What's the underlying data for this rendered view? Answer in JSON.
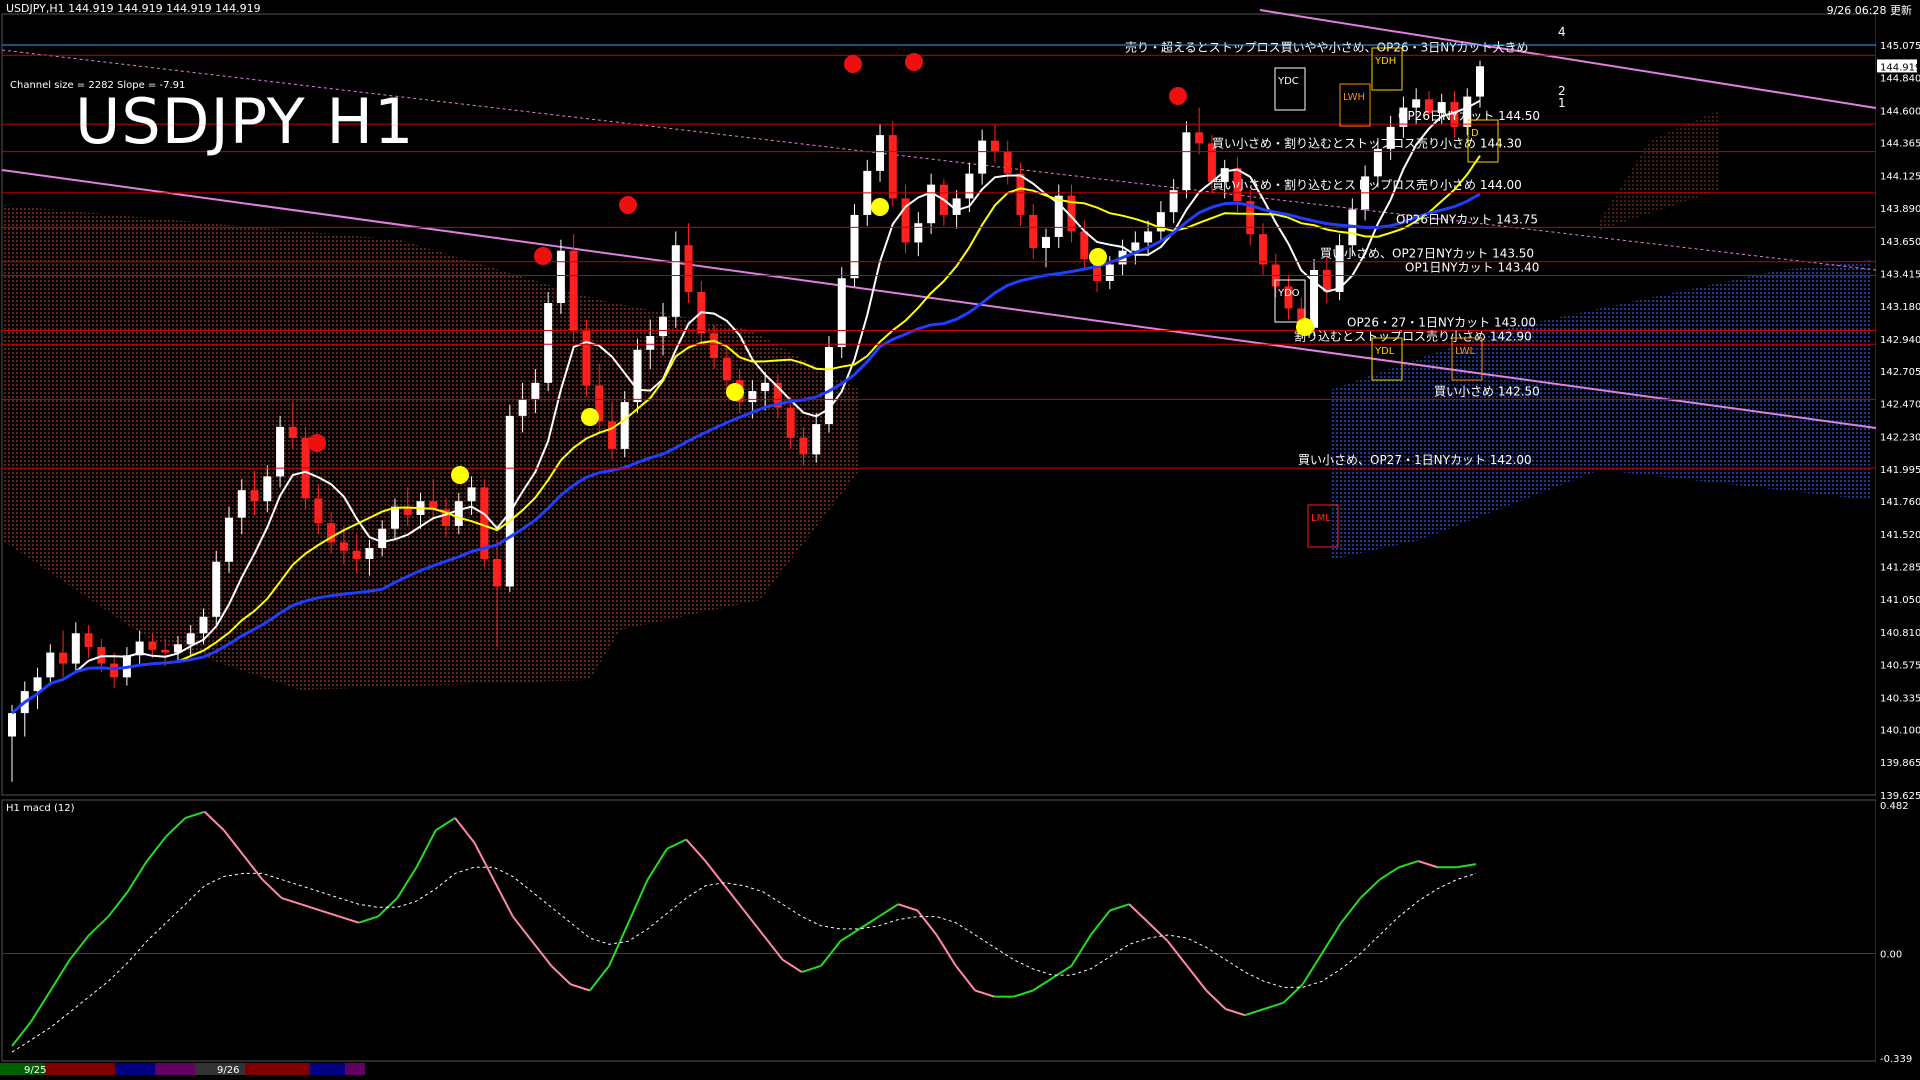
{
  "header": {
    "symbol_line": "USDJPY,H1  144.919 144.919 144.919 144.919",
    "time_line": "9/26 06:28 更新",
    "title": "USDJPY H1",
    "channel_info": "Channel size = 2282 Slope = -7.91",
    "macd_label": "H1  macd (12)"
  },
  "chart_data": [
    {
      "type": "candlestick",
      "title": "USDJPY H1",
      "ylim": [
        139.625,
        145.3
      ],
      "price_axis_ticks": [
        "145.075",
        "144.840",
        "144.600",
        "144.365",
        "144.125",
        "143.890",
        "143.650",
        "143.415",
        "143.180",
        "142.940",
        "142.705",
        "142.470",
        "142.230",
        "141.995",
        "141.760",
        "141.520",
        "141.285",
        "141.050",
        "140.810",
        "140.575",
        "140.335",
        "140.100",
        "139.865",
        "139.625"
      ],
      "current_price": "144.919",
      "x_date_labels": [
        "9/25",
        "9/26"
      ],
      "horizontal_levels": [
        {
          "price": 145.0,
          "label": "売り・超えるとストップロス買いやや小さめ、OP26・3日NYカット大きめ"
        },
        {
          "price": 144.5,
          "label": "OP26日NYカット 144.50"
        },
        {
          "price": 144.3,
          "label": "買い小さめ・割り込むとストップロス売り小さめ 144.30"
        },
        {
          "price": 144.0,
          "label": "買い小さめ・割り込むとストップロス売り小さめ 144.00"
        },
        {
          "price": 143.75,
          "label": "OP26日NYカット 143.75"
        },
        {
          "price": 143.5,
          "label": "買い小さめ、OP27日NYカット 143.50"
        },
        {
          "price": 143.4,
          "label": "OP1日NYカット 143.40"
        },
        {
          "price": 143.0,
          "label": "OP26・27・1日NYカット 143.00"
        },
        {
          "price": 142.9,
          "label": "割り込むとストップロス売り小さめ 142.90"
        },
        {
          "price": 142.5,
          "label": "買い小さめ 142.50"
        },
        {
          "price": 142.0,
          "label": "買い小さめ、OP27・1日NYカット 142.00"
        }
      ],
      "box_markers": [
        "YDH",
        "YDC",
        "LWH",
        "YDO",
        "YDL",
        "LML",
        "LWL",
        "D"
      ],
      "target_markers": [
        "4",
        "2",
        "1"
      ],
      "candles": [
        [
          140.05,
          140.28,
          139.72,
          140.22
        ],
        [
          140.22,
          140.45,
          140.05,
          140.38
        ],
        [
          140.38,
          140.55,
          140.25,
          140.48
        ],
        [
          140.48,
          140.72,
          140.42,
          140.66
        ],
        [
          140.66,
          140.82,
          140.48,
          140.58
        ],
        [
          140.58,
          140.88,
          140.52,
          140.8
        ],
        [
          140.8,
          140.86,
          140.62,
          140.7
        ],
        [
          140.7,
          140.76,
          140.52,
          140.58
        ],
        [
          140.58,
          140.66,
          140.4,
          140.48
        ],
        [
          140.48,
          140.7,
          140.42,
          140.64
        ],
        [
          140.64,
          140.82,
          140.58,
          140.74
        ],
        [
          140.74,
          140.8,
          140.62,
          140.68
        ],
        [
          140.68,
          140.76,
          140.56,
          140.66
        ],
        [
          140.66,
          140.78,
          140.6,
          140.72
        ],
        [
          140.72,
          140.86,
          140.64,
          140.8
        ],
        [
          140.8,
          140.98,
          140.72,
          140.92
        ],
        [
          140.92,
          141.4,
          140.86,
          141.32
        ],
        [
          141.32,
          141.72,
          141.24,
          141.64
        ],
        [
          141.64,
          141.92,
          141.52,
          141.84
        ],
        [
          141.84,
          141.98,
          141.66,
          141.76
        ],
        [
          141.76,
          142.02,
          141.68,
          141.94
        ],
        [
          141.94,
          142.38,
          141.86,
          142.3
        ],
        [
          142.3,
          142.48,
          142.14,
          142.22
        ],
        [
          142.22,
          142.3,
          141.7,
          141.78
        ],
        [
          141.78,
          141.88,
          141.52,
          141.6
        ],
        [
          141.6,
          141.68,
          141.38,
          141.46
        ],
        [
          141.46,
          141.58,
          141.3,
          141.4
        ],
        [
          141.4,
          141.52,
          141.24,
          141.34
        ],
        [
          141.34,
          141.48,
          141.22,
          141.42
        ],
        [
          141.42,
          141.62,
          141.36,
          141.56
        ],
        [
          141.56,
          141.78,
          141.48,
          141.72
        ],
        [
          141.72,
          141.86,
          141.58,
          141.66
        ],
        [
          141.66,
          141.82,
          141.56,
          141.76
        ],
        [
          141.76,
          141.92,
          141.64,
          141.7
        ],
        [
          141.7,
          141.78,
          141.5,
          141.58
        ],
        [
          141.58,
          141.82,
          141.52,
          141.76
        ],
        [
          141.76,
          141.94,
          141.66,
          141.86
        ],
        [
          141.86,
          141.92,
          141.28,
          141.34
        ],
        [
          141.34,
          141.48,
          140.7,
          141.14
        ],
        [
          141.14,
          142.46,
          141.1,
          142.38
        ],
        [
          142.38,
          142.62,
          142.26,
          142.5
        ],
        [
          142.5,
          142.72,
          142.4,
          142.62
        ],
        [
          142.62,
          143.28,
          142.56,
          143.2
        ],
        [
          143.2,
          143.66,
          143.12,
          143.58
        ],
        [
          143.58,
          143.7,
          142.92,
          143.0
        ],
        [
          143.0,
          143.08,
          142.52,
          142.6
        ],
        [
          142.6,
          142.76,
          142.26,
          142.34
        ],
        [
          142.34,
          142.48,
          142.06,
          142.14
        ],
        [
          142.14,
          142.56,
          142.08,
          142.48
        ],
        [
          142.48,
          142.94,
          142.4,
          142.86
        ],
        [
          142.86,
          143.08,
          142.72,
          142.96
        ],
        [
          142.96,
          143.2,
          142.82,
          143.1
        ],
        [
          143.1,
          143.72,
          143.02,
          143.62
        ],
        [
          143.62,
          143.78,
          143.2,
          143.28
        ],
        [
          143.28,
          143.36,
          142.9,
          142.98
        ],
        [
          142.98,
          143.04,
          142.72,
          142.8
        ],
        [
          142.8,
          142.88,
          142.56,
          142.64
        ],
        [
          142.64,
          142.72,
          142.4,
          142.48
        ],
        [
          142.48,
          142.64,
          142.36,
          142.56
        ],
        [
          142.56,
          142.7,
          142.42,
          142.62
        ],
        [
          142.62,
          142.68,
          142.36,
          142.44
        ],
        [
          142.44,
          142.52,
          142.14,
          142.22
        ],
        [
          142.22,
          142.3,
          142.02,
          142.1
        ],
        [
          142.1,
          142.4,
          142.04,
          142.32
        ],
        [
          142.32,
          142.96,
          142.26,
          142.88
        ],
        [
          142.88,
          143.46,
          142.8,
          143.38
        ],
        [
          143.38,
          143.92,
          143.32,
          143.84
        ],
        [
          143.84,
          144.24,
          143.76,
          144.16
        ],
        [
          144.16,
          144.5,
          144.08,
          144.42
        ],
        [
          144.42,
          144.52,
          143.9,
          143.96
        ],
        [
          143.96,
          144.06,
          143.56,
          143.64
        ],
        [
          143.64,
          143.86,
          143.54,
          143.78
        ],
        [
          143.78,
          144.14,
          143.7,
          144.06
        ],
        [
          144.06,
          144.1,
          143.76,
          143.84
        ],
        [
          143.84,
          144.02,
          143.74,
          143.96
        ],
        [
          143.96,
          144.22,
          143.86,
          144.14
        ],
        [
          144.14,
          144.46,
          144.06,
          144.38
        ],
        [
          144.38,
          144.5,
          144.22,
          144.3
        ],
        [
          144.3,
          144.38,
          144.06,
          144.14
        ],
        [
          144.14,
          144.22,
          143.76,
          143.84
        ],
        [
          143.84,
          143.92,
          143.52,
          143.6
        ],
        [
          143.6,
          143.74,
          143.46,
          143.68
        ],
        [
          143.68,
          144.06,
          143.6,
          143.98
        ],
        [
          143.98,
          144.06,
          143.64,
          143.72
        ],
        [
          143.72,
          143.8,
          143.44,
          143.52
        ],
        [
          143.52,
          143.6,
          143.28,
          143.36
        ],
        [
          143.36,
          143.54,
          143.3,
          143.48
        ],
        [
          143.48,
          143.66,
          143.4,
          143.58
        ],
        [
          143.58,
          143.72,
          143.48,
          143.64
        ],
        [
          143.64,
          143.8,
          143.54,
          143.72
        ],
        [
          143.72,
          143.94,
          143.64,
          143.86
        ],
        [
          143.86,
          144.1,
          143.78,
          144.02
        ],
        [
          144.02,
          144.52,
          143.96,
          144.44
        ],
        [
          144.44,
          144.62,
          144.28,
          144.36
        ],
        [
          144.36,
          144.42,
          144.0,
          144.08
        ],
        [
          144.08,
          144.24,
          143.96,
          144.18
        ],
        [
          144.18,
          144.26,
          143.86,
          143.94
        ],
        [
          143.94,
          144.02,
          143.62,
          143.7
        ],
        [
          143.7,
          143.78,
          143.4,
          143.48
        ],
        [
          143.48,
          143.56,
          143.24,
          143.32
        ],
        [
          143.32,
          143.4,
          143.08,
          143.16
        ],
        [
          143.16,
          143.24,
          142.94,
          143.02
        ],
        [
          143.02,
          143.52,
          142.96,
          143.44
        ],
        [
          143.44,
          143.56,
          143.2,
          143.28
        ],
        [
          143.28,
          143.7,
          143.22,
          143.62
        ],
        [
          143.62,
          143.96,
          143.54,
          143.88
        ],
        [
          143.88,
          144.2,
          143.8,
          144.12
        ],
        [
          144.12,
          144.4,
          144.04,
          144.32
        ],
        [
          144.32,
          144.56,
          144.24,
          144.48
        ],
        [
          144.48,
          144.7,
          144.4,
          144.62
        ],
        [
          144.62,
          144.76,
          144.5,
          144.68
        ],
        [
          144.68,
          144.74,
          144.54,
          144.58
        ],
        [
          144.58,
          144.72,
          144.5,
          144.66
        ],
        [
          144.66,
          144.74,
          144.4,
          144.48
        ],
        [
          144.48,
          144.76,
          144.42,
          144.7
        ],
        [
          144.7,
          144.96,
          144.62,
          144.92
        ]
      ]
    },
    {
      "type": "line",
      "title": "H1  macd (12)",
      "ylim": [
        -0.339,
        0.482
      ],
      "y_ticks": [
        "0.482",
        "0.00",
        "-0.339"
      ],
      "series": [
        {
          "values": [
            -0.3,
            -0.22,
            -0.12,
            -0.02,
            0.06,
            0.12,
            0.2,
            0.3,
            0.38,
            0.44,
            0.46,
            0.4,
            0.32,
            0.24,
            0.18,
            0.16,
            0.14,
            0.12,
            0.1,
            0.12,
            0.18,
            0.28,
            0.4,
            0.44,
            0.36,
            0.24,
            0.12,
            0.04,
            -0.04,
            -0.1,
            -0.12,
            -0.04,
            0.1,
            0.24,
            0.34,
            0.37,
            0.3,
            0.22,
            0.14,
            0.06,
            -0.02,
            -0.06,
            -0.04,
            0.04,
            0.08,
            0.12,
            0.16,
            0.14,
            0.06,
            -0.04,
            -0.12,
            -0.14,
            -0.14,
            -0.12,
            -0.08,
            -0.04,
            0.06,
            0.14,
            0.16,
            0.1,
            0.04,
            -0.04,
            -0.12,
            -0.18,
            -0.2,
            -0.18,
            -0.16,
            -0.1,
            0.0,
            0.1,
            0.18,
            0.24,
            0.28,
            0.3,
            0.28,
            0.28,
            0.29
          ]
        },
        {
          "values": [
            -0.32,
            -0.28,
            -0.24,
            -0.19,
            -0.14,
            -0.09,
            -0.03,
            0.04,
            0.1,
            0.16,
            0.22,
            0.25,
            0.26,
            0.26,
            0.24,
            0.22,
            0.2,
            0.18,
            0.16,
            0.15,
            0.15,
            0.17,
            0.21,
            0.26,
            0.28,
            0.28,
            0.25,
            0.2,
            0.15,
            0.1,
            0.05,
            0.03,
            0.04,
            0.08,
            0.13,
            0.18,
            0.22,
            0.23,
            0.22,
            0.2,
            0.16,
            0.12,
            0.09,
            0.08,
            0.08,
            0.09,
            0.11,
            0.12,
            0.12,
            0.1,
            0.06,
            0.02,
            -0.02,
            -0.05,
            -0.07,
            -0.07,
            -0.05,
            -0.01,
            0.03,
            0.05,
            0.06,
            0.05,
            0.02,
            -0.02,
            -0.06,
            -0.09,
            -0.11,
            -0.11,
            -0.09,
            -0.05,
            0.0,
            0.06,
            0.12,
            0.17,
            0.21,
            0.24,
            0.26
          ]
        }
      ]
    }
  ]
}
